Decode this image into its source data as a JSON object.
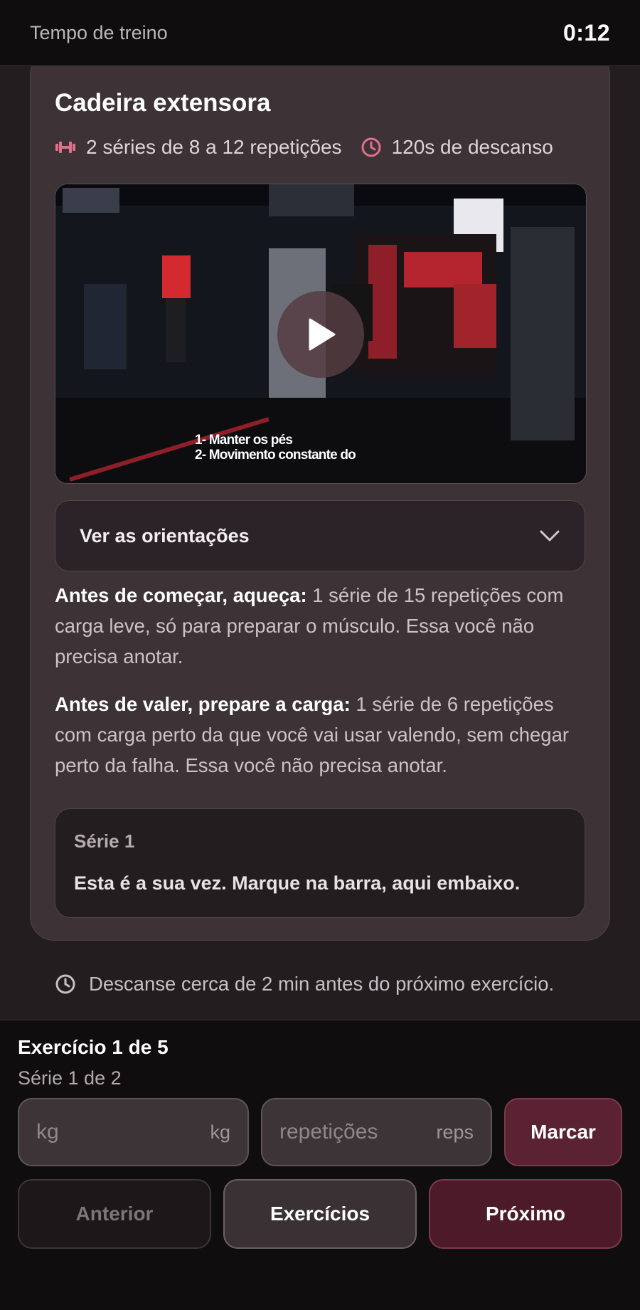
{
  "header": {
    "label": "Tempo de treino",
    "timer": "0:12"
  },
  "exercise": {
    "title": "Cadeira extensora",
    "sets_info": "2 séries de 8 a 12 repetições",
    "rest_info": "120s de descanso",
    "video_caption_1": "1- Manter os pés",
    "video_caption_2": "2- Movimento constante do",
    "guidance_label": "Ver as orientações",
    "warmup_bold": "Antes de começar, aqueça:",
    "warmup_text": " 1 série de 15 repetições com carga leve, só para preparar o músculo. Essa você não precisa anotar.",
    "prep_bold": "Antes de valer, prepare a carga:",
    "prep_text": " 1 série de 6 repetições com carga perto da que você vai usar valendo, sem chegar perto da falha. Essa você não precisa anotar.",
    "serie_label": "Série 1",
    "serie_text": "Esta é a sua vez. Marque na barra, aqui embaixo."
  },
  "rest_note": "Descanse cerca de 2 min antes do próximo exercício.",
  "footer": {
    "exercise_count": "Exercício 1 de 5",
    "set_count": "Série 1 de 2",
    "kg_placeholder": "kg",
    "kg_unit": "kg",
    "reps_placeholder": "repetições",
    "reps_unit": "reps",
    "mark_label": "Marcar",
    "prev_label": "Anterior",
    "list_label": "Exercícios",
    "next_label": "Próximo"
  },
  "colors": {
    "accent": "#e0708e",
    "primary_button": "#5b2233"
  },
  "icons": {
    "sets": "dumbbell-icon",
    "rest": "clock-icon",
    "guidance": "chevron-down-icon",
    "video": "play-icon"
  }
}
